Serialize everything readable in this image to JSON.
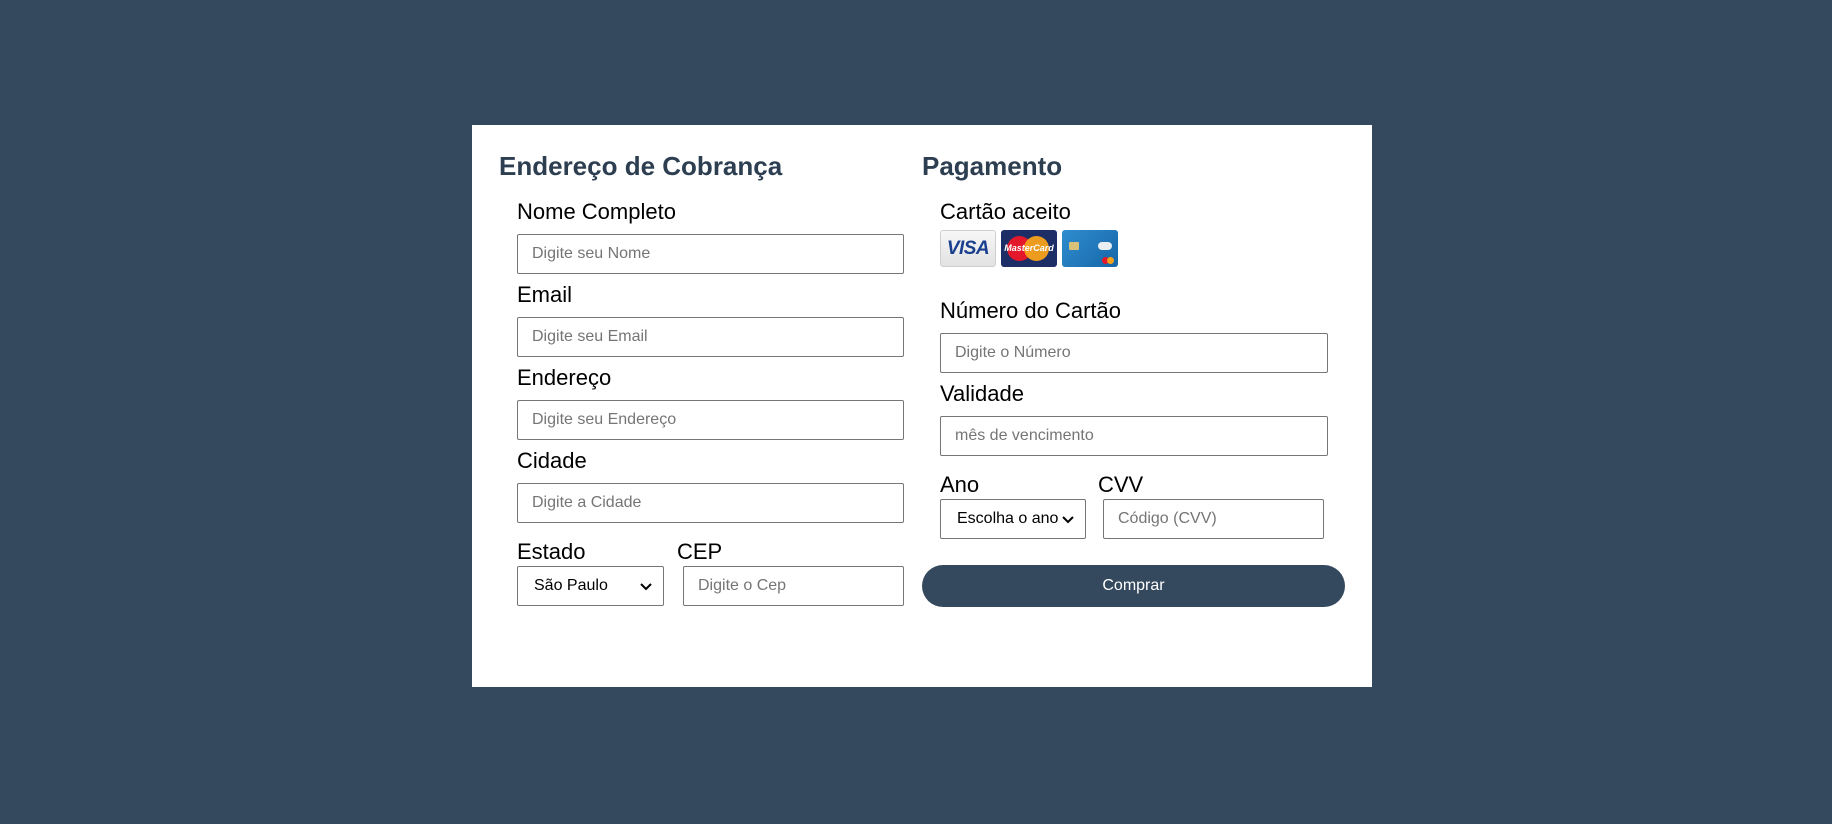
{
  "billing": {
    "title": "Endereço de Cobrança",
    "fields": {
      "name": {
        "label": "Nome Completo",
        "placeholder": "Digite seu Nome"
      },
      "email": {
        "label": "Email",
        "placeholder": "Digite seu Email"
      },
      "address": {
        "label": "Endereço",
        "placeholder": "Digite seu Endereço"
      },
      "city": {
        "label": "Cidade",
        "placeholder": "Digite a Cidade"
      },
      "state": {
        "label": "Estado",
        "value": "São Paulo"
      },
      "cep": {
        "label": "CEP",
        "placeholder": "Digite o Cep"
      }
    }
  },
  "payment": {
    "title": "Pagamento",
    "accepted_label": "Cartão aceito",
    "accepted_cards": [
      {
        "icon": "visa-card-icon",
        "text": "VISA"
      },
      {
        "icon": "mastercard-card-icon",
        "text": "MasterCard"
      },
      {
        "icon": "maestro-card-icon"
      }
    ],
    "fields": {
      "card_number": {
        "label": "Número do Cartão",
        "placeholder": "Digite o Número"
      },
      "expiry": {
        "label": "Validade",
        "placeholder": "mês de vencimento"
      },
      "year": {
        "label": "Ano",
        "value": "Escolha o ano"
      },
      "cvv": {
        "label": "CVV",
        "placeholder": "Código (CVV)"
      }
    },
    "submit_label": "Comprar"
  },
  "colors": {
    "background": "#34495e",
    "card": "#ffffff",
    "heading": "#2c3e50",
    "button": "#34495e"
  }
}
